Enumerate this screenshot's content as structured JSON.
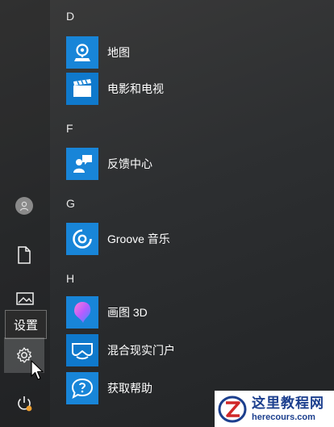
{
  "rail": {
    "tooltip": "设置",
    "icons": [
      "avatar-icon",
      "document-icon",
      "pictures-icon",
      "gear-icon",
      "power-icon"
    ]
  },
  "sections": [
    {
      "letter": "D",
      "apps": [
        {
          "label": "地图",
          "icon": "maps-icon"
        },
        {
          "label": "电影和电视",
          "icon": "movies-tv-icon"
        }
      ]
    },
    {
      "letter": "F",
      "apps": [
        {
          "label": "反馈中心",
          "icon": "feedback-hub-icon"
        }
      ]
    },
    {
      "letter": "G",
      "apps": [
        {
          "label": "Groove 音乐",
          "icon": "groove-music-icon"
        }
      ]
    },
    {
      "letter": "H",
      "apps": [
        {
          "label": "画图 3D",
          "icon": "paint-3d-icon"
        },
        {
          "label": "混合现实门户",
          "icon": "mixed-reality-icon"
        }
      ]
    }
  ],
  "extra_app": {
    "label": "获取帮助",
    "icon": "get-help-icon"
  },
  "colors": {
    "tile": "#1885d8",
    "rail_highlight": "#5a5a5a",
    "power_badge": "#f0a030"
  },
  "watermark": {
    "title": "这里教程网",
    "url": "herecours.com"
  }
}
